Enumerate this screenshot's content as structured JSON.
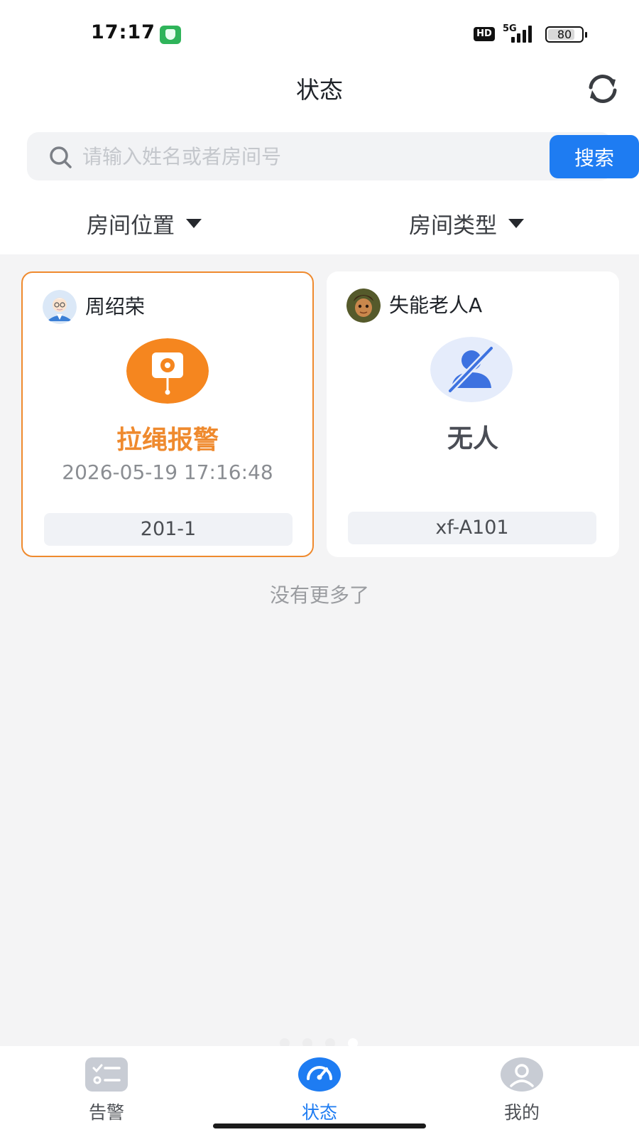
{
  "status_bar": {
    "time": "17:17",
    "hd_label": "HD",
    "network": "5G",
    "battery": "80",
    "battery_level": 0.8,
    "app_icon": "shield-app-icon"
  },
  "header": {
    "title": "状态",
    "refresh_icon": "refresh-icon"
  },
  "search": {
    "placeholder": "请输入姓名或者房间号",
    "value": "",
    "button_label": "搜索",
    "icon": "search-icon"
  },
  "filters": [
    {
      "label": "房间位置",
      "icon": "caret-down-icon"
    },
    {
      "label": "房间类型",
      "icon": "caret-down-icon"
    }
  ],
  "cards": [
    {
      "name": "周绍荣",
      "avatar": "elderly-man-avatar",
      "status_icon": "pull-cord-alarm-icon",
      "status": "拉绳报警",
      "time": "2026-05-19 17:16:48",
      "room": "201-1",
      "accent_color": "#ef8a2e"
    },
    {
      "name": "失能老人A",
      "avatar": "cartoon-character-avatar",
      "status_icon": "no-person-icon",
      "status": "无人",
      "time": "",
      "room": "xf-A101",
      "accent_color": "#4a4d55"
    }
  ],
  "list_footer": "没有更多了",
  "pager": {
    "count": 4,
    "active": 3
  },
  "tabs": [
    {
      "label": "告警",
      "icon": "alarm-list-icon",
      "active": false
    },
    {
      "label": "状态",
      "icon": "dashboard-gauge-icon",
      "active": true
    },
    {
      "label": "我的",
      "icon": "profile-icon",
      "active": false
    }
  ],
  "colors": {
    "primary": "#1e7cf2",
    "alert": "#ef8a2e",
    "background": "#f4f4f5"
  }
}
